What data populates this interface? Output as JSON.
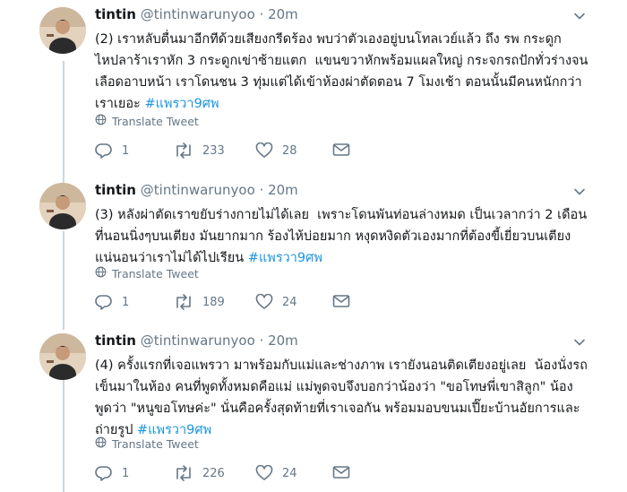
{
  "tweets": [
    {
      "name": "tintin",
      "handle": "@tintinwarunyoo",
      "separator": "·",
      "time": "20m",
      "text": "(2) เราหลับตื่นมาอีกทีด้วยเสียงกรีดร้อง พบว่าตัวเองอยู่บนโทลเวย์แล้ว ถึง รพ กระดูก\nไหปลาร้าเราหัก 3 กระดูกเข่าซ้ายแตก  แขนขวาหักพร้อมแผลใหญ่ กระจกรถปักทั่วร่างจน\nเลือดอาบหน้า เราโดนชน 3 ทุ่มแต่ได้เข้าห้องผ่าตัดตอน 7 โมงเช้า ตอนนั้นมีคนหนักกว่า\nเราเยอะ ",
      "hashtag": "#แพรวา9ศพ",
      "translate_label": "Translate Tweet",
      "replies": "1",
      "retweets": "233",
      "likes": "28"
    },
    {
      "name": "tintin",
      "handle": "@tintinwarunyoo",
      "separator": "·",
      "time": "20m",
      "text": "(3) หลังผ่าตัดเราขยับร่างกายไม่ได้เลย  เพราะโดนพันท่อนล่างหมด เป็นเวลากว่า 2 เดือน\nที่นอนนิ่งๆบนเตียง มันยากมาก ร้องไห้บ่อยมาก หงุดหงิดตัวเองมากที่ต้องขี้เยี่ยวบนเตียง\nแน่นอนว่าเราไม่ได้ไปเรียน ",
      "hashtag": "#แพรวา9ศพ",
      "translate_label": "Translate Tweet",
      "replies": "1",
      "retweets": "189",
      "likes": "24"
    },
    {
      "name": "tintin",
      "handle": "@tintinwarunyoo",
      "separator": "·",
      "time": "20m",
      "text": "(4) ครั้งแรกที่เจอแพรวา มาพร้อมกับแม่และช่างภาพ เรายังนอนติดเตียงอยู่เลย  น้องนั่งรถ\nเข็นมาในห้อง คนที่พูดทั้งหมดคือแม่ แม่พูดจบจึงบอกว่าน้องว่า \"ขอโทษพี่เขาสิลูก\" น้อง\nพูดว่า \"หนูขอโทษค่ะ\" นั่นคือครั้งสุดท้ายที่เราเจอกัน พร้อมมอบขนมเปี๊ยะบ้านอัยการและ\nถ่ายรูป ",
      "hashtag": "#แพรวา9ศพ",
      "translate_label": "Translate Tweet",
      "replies": "1",
      "retweets": "226",
      "likes": "24"
    }
  ],
  "colors": {
    "accent": "#1b95e0",
    "muted": "#657786",
    "text": "#14171a",
    "thread": "#ccd6dd"
  },
  "icons": {
    "reply": "reply-icon",
    "retweet": "retweet-icon",
    "like": "heart-icon",
    "dm": "envelope-icon",
    "translate": "globe-icon",
    "menu": "chevron-down-icon"
  }
}
